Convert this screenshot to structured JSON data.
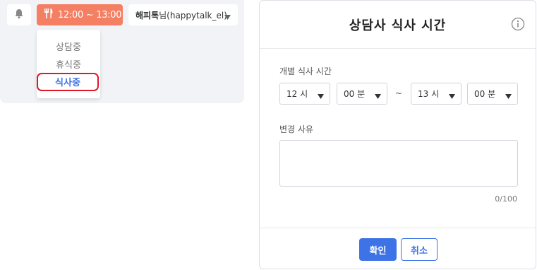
{
  "toolbar": {
    "bell_icon": "bell-icon",
    "meal_icon": "utensils-icon",
    "meal_time": "12:00 ~ 13:00",
    "user_name": "해피톡",
    "user_suffix": "님(happytalk_el)"
  },
  "status_menu": {
    "items": [
      "상담중",
      "휴식중",
      "식사중"
    ],
    "selected": "식사중"
  },
  "modal": {
    "title": "상담사 식사 시간",
    "meal_time_label": "개별 식사 시간",
    "start_hour": "12 시",
    "start_minute": "00 분",
    "separator": "~",
    "end_hour": "13 시",
    "end_minute": "00 분",
    "reason_label": "변경 사유",
    "reason_value": "",
    "counter": "0/100",
    "ok_label": "확인",
    "cancel_label": "취소"
  },
  "colors": {
    "meal_button": "#f47f63",
    "primary": "#3d73e6",
    "highlight_border": "#e0182a"
  }
}
